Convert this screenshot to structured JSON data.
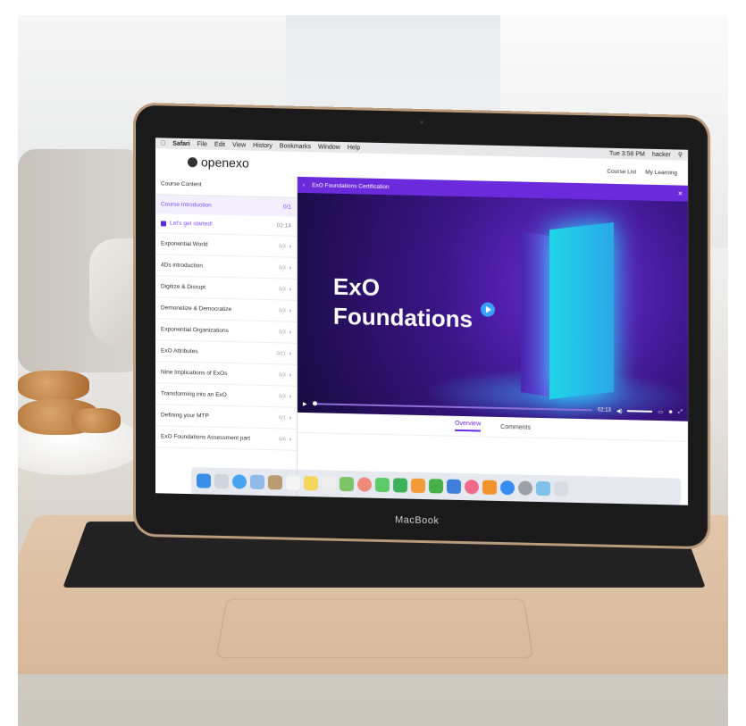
{
  "menubar": {
    "app": "Safari",
    "items": [
      "File",
      "Edit",
      "View",
      "History",
      "Bookmarks",
      "Window",
      "Help"
    ],
    "clock": "Tue 3:58 PM",
    "user": "hacker"
  },
  "header": {
    "logo": "openexo",
    "links": [
      "Course List",
      "My Learning"
    ]
  },
  "sidebar": {
    "title": "Course Content",
    "section": {
      "label": "Course Introduction",
      "count": "0/1"
    },
    "current_lesson": {
      "label": "Let's get started!",
      "duration": "02:14"
    },
    "items": [
      {
        "label": "Exponential World",
        "count": "0/3"
      },
      {
        "label": "4Ds introduction",
        "count": "0/3"
      },
      {
        "label": "Digitize & Disrupt",
        "count": "0/3"
      },
      {
        "label": "Demonetize & Democratize",
        "count": "0/3"
      },
      {
        "label": "Exponential Organizations",
        "count": "0/3"
      },
      {
        "label": "ExO Attributes",
        "count": "0/11"
      },
      {
        "label": "Nine Implications of ExOs",
        "count": "0/3"
      },
      {
        "label": "Transforming into an ExO",
        "count": "0/3"
      },
      {
        "label": "Defining your MTP",
        "count": "0/1"
      },
      {
        "label": "ExO Foundations Assessment part",
        "count": "0/9"
      }
    ]
  },
  "video": {
    "header_title": "ExO Foundations Certification",
    "title_line1": "ExO",
    "title_line2": "Foundations",
    "time": "02:13"
  },
  "tabs": {
    "overview": "Overview",
    "comments": "Comments"
  },
  "device": {
    "label": "MacBook"
  }
}
